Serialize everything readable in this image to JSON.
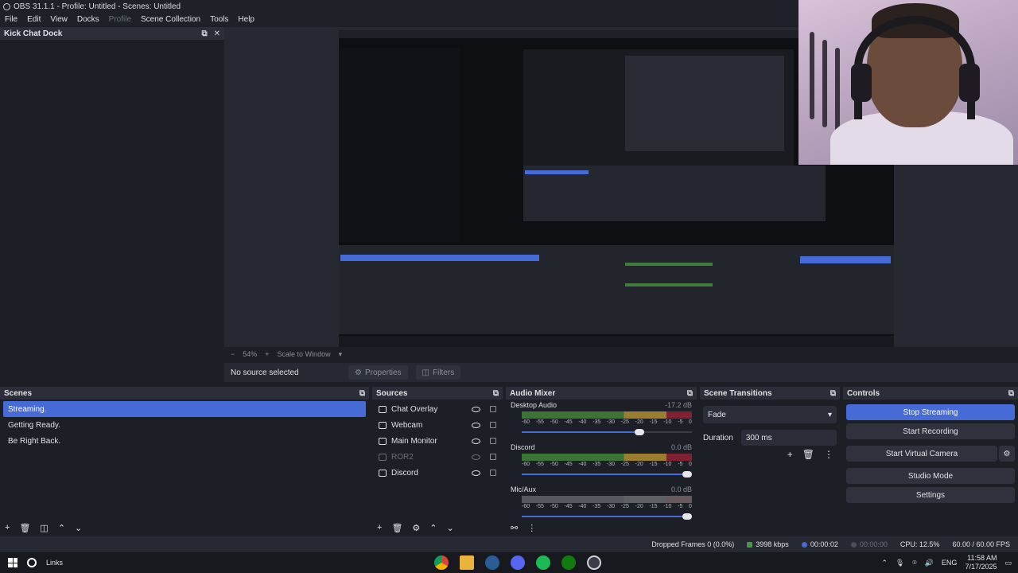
{
  "window": {
    "title": "OBS 31.1.1 - Profile: Untitled - Scenes: Untitled"
  },
  "menu": [
    {
      "label": "File",
      "enabled": true
    },
    {
      "label": "Edit",
      "enabled": true
    },
    {
      "label": "View",
      "enabled": true
    },
    {
      "label": "Docks",
      "enabled": true
    },
    {
      "label": "Profile",
      "enabled": false
    },
    {
      "label": "Scene Collection",
      "enabled": true
    },
    {
      "label": "Tools",
      "enabled": true
    },
    {
      "label": "Help",
      "enabled": true
    }
  ],
  "kick_dock": {
    "title": "Kick Chat Dock"
  },
  "preview": {
    "zoom": "54%",
    "scale_mode": "Scale to Window"
  },
  "source_bar": {
    "no_source": "No source selected",
    "properties": "Properties",
    "filters": "Filters"
  },
  "scenes": {
    "title": "Scenes",
    "items": [
      "Streaming.",
      "Getting Ready.",
      "Be Right Back."
    ],
    "active_index": 0
  },
  "sources": {
    "title": "Sources",
    "items": [
      {
        "name": "Chat Overlay",
        "visible": true
      },
      {
        "name": "Webcam",
        "visible": true
      },
      {
        "name": "Main Monitor",
        "visible": true
      },
      {
        "name": "ROR2",
        "visible": false
      },
      {
        "name": "Discord",
        "visible": true
      }
    ]
  },
  "audio_mixer": {
    "title": "Audio Mixer",
    "scale": [
      "-60",
      "-55",
      "-50",
      "-45",
      "-40",
      "-35",
      "-30",
      "-25",
      "-20",
      "-15",
      "-10",
      "-5",
      "0"
    ],
    "channels": [
      {
        "name": "Desktop Audio",
        "db": "-17.2 dB",
        "volume": 0.72,
        "active": true
      },
      {
        "name": "Discord",
        "db": "0.0 dB",
        "volume": 1.0,
        "active": true
      },
      {
        "name": "Mic/Aux",
        "db": "0.0 dB",
        "volume": 1.0,
        "active": false
      }
    ]
  },
  "scene_transitions": {
    "title": "Scene Transitions",
    "transition": "Fade",
    "duration_label": "Duration",
    "duration_value": "300 ms"
  },
  "controls": {
    "title": "Controls",
    "stop_streaming": "Stop Streaming",
    "start_recording": "Start Recording",
    "start_virtual_camera": "Start Virtual Camera",
    "studio_mode": "Studio Mode",
    "settings": "Settings"
  },
  "status": {
    "dropped_frames": "Dropped Frames 0 (0.0%)",
    "bitrate": "3998 kbps",
    "stream_time": "00:00:02",
    "record_time": "00:00:00",
    "cpu": "CPU: 12.5%",
    "fps": "60.00 / 60.00 FPS"
  },
  "taskbar": {
    "search_text": "Links",
    "language": "ENG",
    "time": "11:58 AM",
    "date": "7/17/2025"
  },
  "colors": {
    "accent": "#476bd6",
    "dock_bg": "#1d1f26",
    "header_bg": "#2b2e38"
  }
}
